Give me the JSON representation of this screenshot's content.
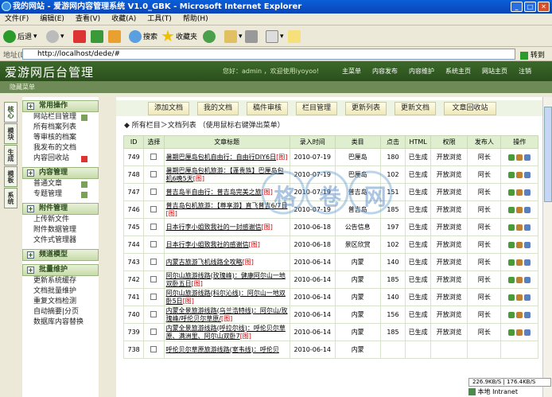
{
  "window": {
    "title": "我的网站 - 爱游网内容管理系统 V1.0_GBK - Microsoft Internet Explorer",
    "min": "_",
    "max": "□",
    "close": "✕"
  },
  "menu": [
    "文件(F)",
    "编辑(E)",
    "查看(V)",
    "收藏(A)",
    "工具(T)",
    "帮助(H)"
  ],
  "toolbar": {
    "back": "后退",
    "search": "搜索",
    "favorites": "收藏夹"
  },
  "address": {
    "label": "地址(D)",
    "url": "http://localhost/dede/#",
    "go": "转到"
  },
  "header": {
    "logo": "爱游网后台管理",
    "user": "您好：admin ，欢迎使用iyoyoo!",
    "nav": [
      "主菜单",
      "内容发布",
      "内容维护",
      "系统主页",
      "网站主页",
      "注销"
    ]
  },
  "subbar": "隐藏菜单",
  "vtabs": [
    "核心",
    "模块",
    "生成",
    "模板",
    "系统"
  ],
  "sidebar": [
    {
      "title": "常用操作",
      "items": [
        "网站栏目管理",
        "所有档案列表",
        "等审核的档案",
        "我发布的文档",
        "内容回收站"
      ]
    },
    {
      "title": "内容管理",
      "items": [
        "普通文章",
        "专题管理"
      ]
    },
    {
      "title": "附件管理",
      "items": [
        "上传新文件",
        "附件数据管理",
        "文件式管理器"
      ]
    },
    {
      "title": "频道模型",
      "items": []
    },
    {
      "title": "批量维护",
      "items": [
        "更新系统缓存",
        "文档批量维护",
        "重复文档检测",
        "自动摘要|分页",
        "数据库内容替换"
      ]
    }
  ],
  "buttons": [
    "添加文档",
    "我的文档",
    "稿件审核",
    "栏目管理",
    "更新列表",
    "更新文档",
    "文章回收站"
  ],
  "crumb": "◆ 所有栏目＞文档列表 （使用鼠标右键弹出菜单）",
  "table": {
    "headers": [
      "ID",
      "选择",
      "文章标题",
      "录入时间",
      "类目",
      "点击",
      "HTML",
      "权限",
      "发布人",
      "操作"
    ],
    "rows": [
      {
        "id": "749",
        "title": "暑期巴厘岛包机自由行：自由行DIY6日",
        "tag": "[图]",
        "date": "2010-07-19",
        "cat": "巴厘岛",
        "hits": "180",
        "html": "已生成",
        "perm": "开放浏览",
        "user": "阿长"
      },
      {
        "id": "748",
        "title": "暑期巴厘岛包机旅游：【蓬贵族】巴厘岛包机6晚5天",
        "tag": "[图]",
        "date": "2010-07-19",
        "cat": "巴厘岛",
        "hits": "102",
        "html": "已生成",
        "perm": "开放浏览",
        "user": "阿长"
      },
      {
        "id": "747",
        "title": "普吉岛半自由行：普吉岛完美之旅",
        "tag": "[图]",
        "date": "2010-07-19",
        "cat": "普吉岛",
        "hits": "151",
        "html": "已生成",
        "perm": "开放浏览",
        "user": "阿长"
      },
      {
        "id": "746",
        "title": "普吉岛包机旅游：【尊享游】直飞普吉6/7日",
        "tag": "[图]",
        "date": "2010-07-19",
        "cat": "普吉岛",
        "hits": "185",
        "html": "已生成",
        "perm": "开放浏览",
        "user": "阿长"
      },
      {
        "id": "745",
        "title": "日本行李小姐致我社的一封感谢信",
        "tag": "[图]",
        "date": "2010-06-18",
        "cat": "公告信息",
        "hits": "197",
        "html": "已生成",
        "perm": "开放浏览",
        "user": "阿长"
      },
      {
        "id": "744",
        "title": "日本行李小姐致我社的感谢信",
        "tag": "[图]",
        "date": "2010-06-18",
        "cat": "景区欣赏",
        "hits": "102",
        "html": "已生成",
        "perm": "开放浏览",
        "user": "阿长"
      },
      {
        "id": "743",
        "title": "内蒙古旅游飞机线路全攻略",
        "tag": "[图]",
        "date": "2010-06-14",
        "cat": "内蒙",
        "hits": "140",
        "html": "已生成",
        "perm": "开放浏览",
        "user": "阿长"
      },
      {
        "id": "742",
        "title": "阿尔山旅游线路(玫瑰峰)：健康阿尔山一地双卧五日",
        "tag": "[图]",
        "date": "2010-06-14",
        "cat": "内蒙",
        "hits": "185",
        "html": "已生成",
        "perm": "开放浏览",
        "user": "阿长"
      },
      {
        "id": "741",
        "title": "阿尔山旅游线路(科尔沁线)：阿尔山一地双卧5日",
        "tag": "[图]",
        "date": "2010-06-14",
        "cat": "内蒙",
        "hits": "140",
        "html": "已生成",
        "perm": "开放浏览",
        "user": "阿长"
      },
      {
        "id": "740",
        "title": "内蒙全景旅游线路(乌兰浩特线)：阿尔山/玫瑰峰/呼伦贝尔草原/",
        "tag": "[图]",
        "date": "2010-06-14",
        "cat": "内蒙",
        "hits": "156",
        "html": "已生成",
        "perm": "开放浏览",
        "user": "阿长"
      },
      {
        "id": "739",
        "title": "内蒙全景旅游线路(呼拉尔线)：呼伦贝尔草原、满洲里、阿尔山双卧7",
        "tag": "[图]",
        "date": "2010-06-14",
        "cat": "内蒙",
        "hits": "185",
        "html": "已生成",
        "perm": "开放浏览",
        "user": "阿长"
      },
      {
        "id": "738",
        "title": "呼伦贝尔草原旅游线路(室韦线)：呼伦贝",
        "tag": "",
        "date": "2010-06-14",
        "cat": "内蒙",
        "hits": "",
        "html": "",
        "perm": "",
        "user": ""
      }
    ]
  },
  "status": {
    "speed": "226.9KB/S | 176.4KB/S",
    "zone": "本地 Intranet"
  },
  "watermark": "格卷网",
  "colors": {
    "header": "#3c6a2a",
    "accent": "#2a4e1c",
    "tag": "#cc0000"
  }
}
